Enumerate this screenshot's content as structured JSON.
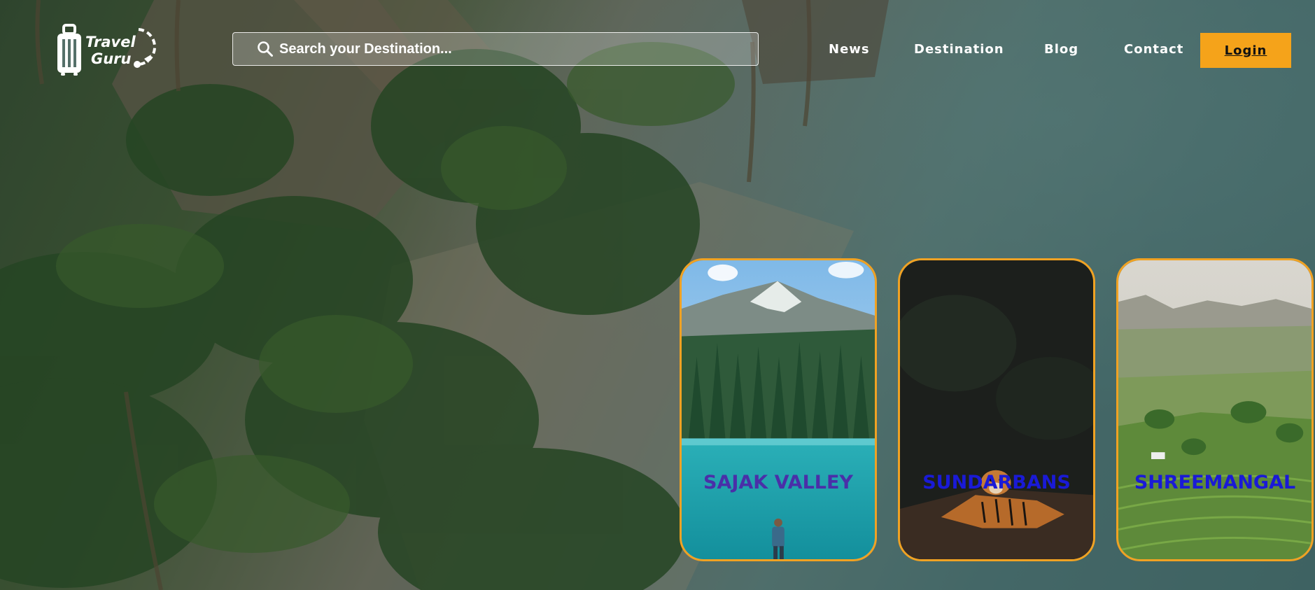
{
  "header": {
    "logo": {
      "line1": "Travel",
      "line2": "Guru"
    },
    "search": {
      "placeholder": "Search your Destination..."
    },
    "nav": [
      {
        "label": "News"
      },
      {
        "label": "Destination"
      },
      {
        "label": "Blog"
      },
      {
        "label": "Contact"
      }
    ],
    "login_label": "Login"
  },
  "destinations": [
    {
      "name": "SAJAK VALLEY",
      "title_color": "#4a2fa8"
    },
    {
      "name": "SUNDARBANS",
      "title_color": "#1a1ad6"
    },
    {
      "name": "SHREEMANGAL",
      "title_color": "#1a1ad6"
    }
  ],
  "colors": {
    "accent": "#f5a31a",
    "card_border": "#f0a223"
  }
}
